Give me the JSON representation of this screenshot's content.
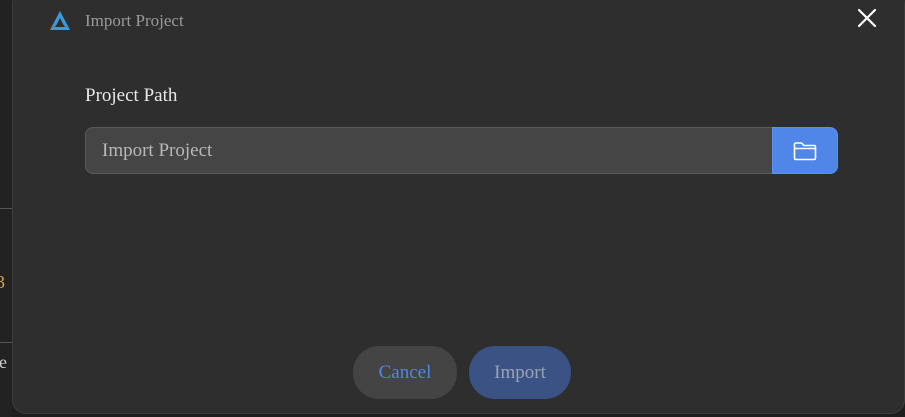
{
  "dialog": {
    "title": "Import Project",
    "field_label": "Project Path",
    "path_input": {
      "value": "",
      "placeholder": "Import Project"
    },
    "browse_icon": "folder-icon",
    "close_icon": "close-icon",
    "buttons": {
      "cancel": "Cancel",
      "import": "Import"
    }
  },
  "background": {
    "partial_char_1": "3",
    "partial_char_2": "je"
  },
  "colors": {
    "accent": "#4f86e8",
    "logo_blue": "#3d9ad8",
    "dialog_bg": "#2e2e2e",
    "disabled_button_bg": "#3a5384"
  }
}
